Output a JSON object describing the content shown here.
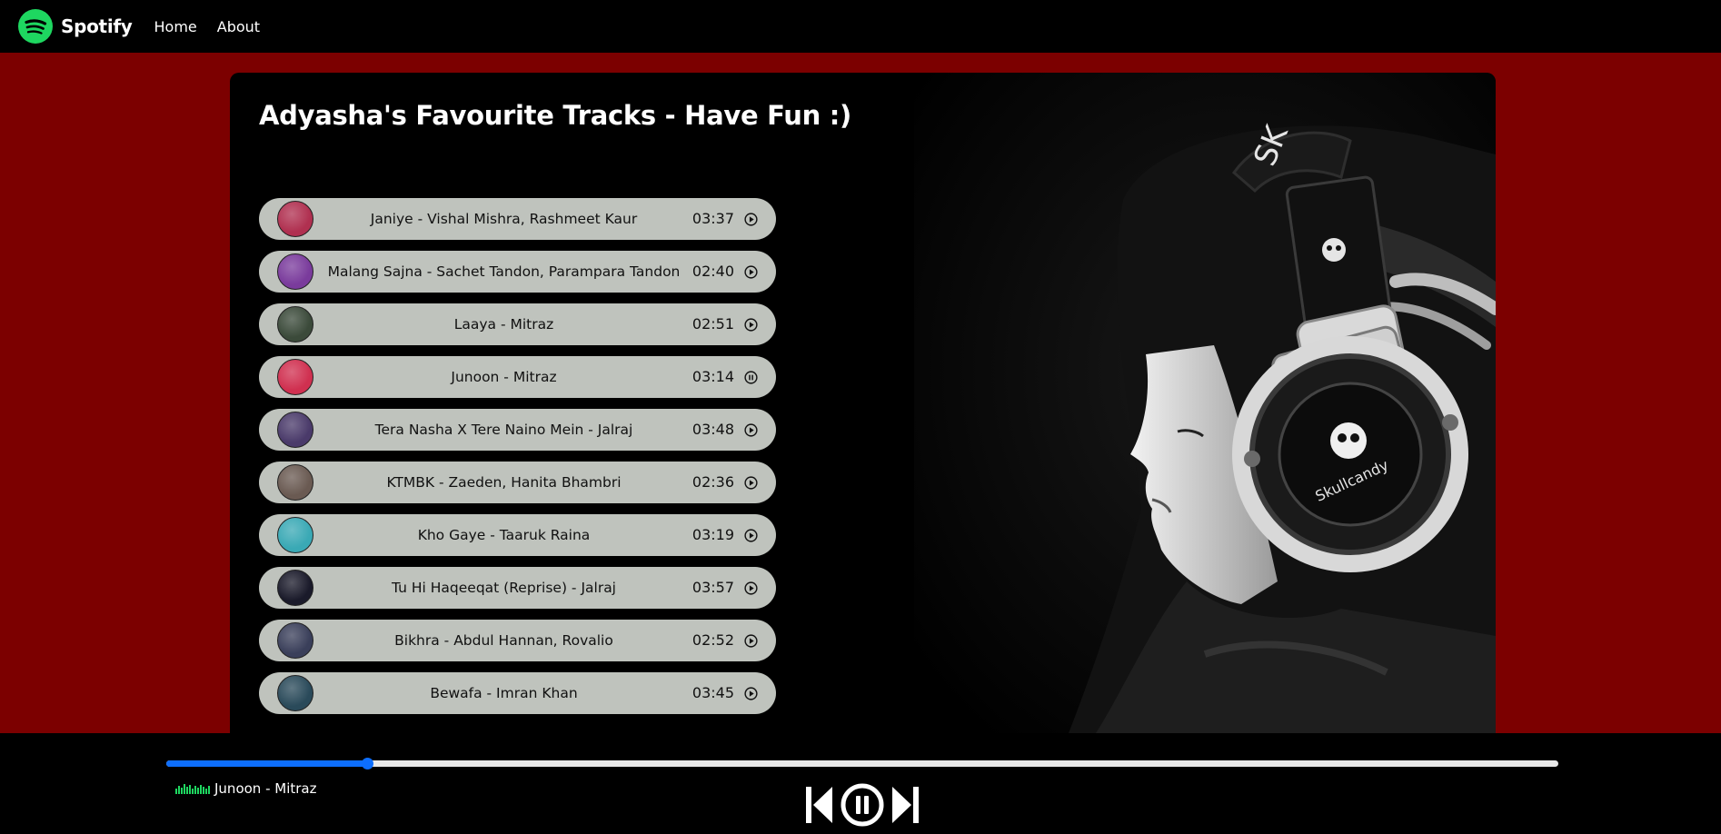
{
  "navbar": {
    "brand": "Spotify",
    "links": [
      "Home",
      "About"
    ]
  },
  "main": {
    "title": "Adyasha's Favourite Tracks - Have Fun :)"
  },
  "songs": [
    {
      "name": "Janiye - Vishal Mishra, Rashmeet Kaur",
      "duration": "03:37",
      "state": "play",
      "cover_color": "#b03050"
    },
    {
      "name": "Malang Sajna - Sachet Tandon, Parampara Tandon",
      "duration": "02:40",
      "state": "play",
      "cover_color": "#7a3b9c"
    },
    {
      "name": "Laaya - Mitraz",
      "duration": "02:51",
      "state": "play",
      "cover_color": "#3b4a3a"
    },
    {
      "name": "Junoon - Mitraz",
      "duration": "03:14",
      "state": "pause",
      "cover_color": "#d03050"
    },
    {
      "name": "Tera Nasha X Tere Naino Mein - Jalraj",
      "duration": "03:48",
      "state": "play",
      "cover_color": "#4a3a6a"
    },
    {
      "name": "KTMBK - Zaeden, Hanita Bhambri",
      "duration": "02:36",
      "state": "play",
      "cover_color": "#6a5a52"
    },
    {
      "name": "Kho Gaye - Taaruk Raina",
      "duration": "03:19",
      "state": "play",
      "cover_color": "#3aa9b5"
    },
    {
      "name": "Tu Hi Haqeeqat (Reprise) - Jalraj",
      "duration": "03:57",
      "state": "play",
      "cover_color": "#1a1a2a"
    },
    {
      "name": "Bikhra - Abdul Hannan, Rovalio",
      "duration": "02:52",
      "state": "play",
      "cover_color": "#3a3f5a"
    },
    {
      "name": "Bewafa - Imran Khan",
      "duration": "03:45",
      "state": "play",
      "cover_color": "#2a4a5a"
    }
  ],
  "player": {
    "now_playing": "Junoon - Mitraz",
    "progress_percent": 14.4
  },
  "colors": {
    "background": "#7c0000",
    "spotify_green": "#1ed760",
    "progress": "#0d6efd"
  }
}
